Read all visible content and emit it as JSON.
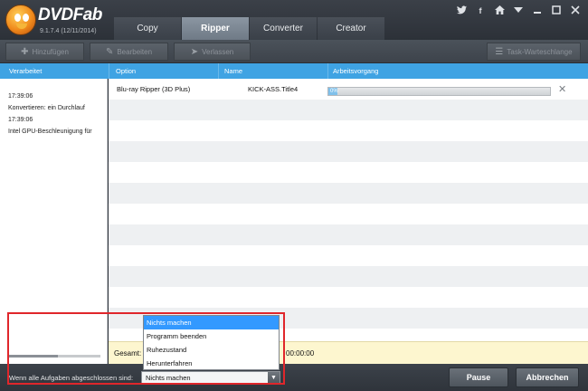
{
  "app": {
    "brand": "DVDFab",
    "version": "9.1.7.4 (12/11/2014)"
  },
  "tabs": [
    {
      "label": "Copy",
      "active": false
    },
    {
      "label": "Ripper",
      "active": true
    },
    {
      "label": "Converter",
      "active": false
    },
    {
      "label": "Creator",
      "active": false
    }
  ],
  "window_icons": [
    "twitter-icon",
    "facebook-icon",
    "home-icon",
    "menu-icon",
    "minimize-icon",
    "maximize-icon",
    "close-icon"
  ],
  "toolbar": {
    "add_label": "Hinzufügen",
    "edit_label": "Bearbeiten",
    "move_label": "Verlassen",
    "queue_label": "Task-Warteschlange",
    "enabled": false
  },
  "columns": {
    "processed": "Verarbeitet",
    "option": "Option",
    "name": "Name",
    "progress": "Arbeitsvorgang"
  },
  "log": [
    "17:39:06",
    "Konvertieren: ein Durchlauf",
    "17:39:06",
    "Intel GPU-Beschleunigung für"
  ],
  "tasks": [
    {
      "option": "Blu-ray Ripper (3D Plus)",
      "name": "KICK-ASS.Title4",
      "progress": 0,
      "progress_text": "0%"
    }
  ],
  "total": {
    "label": "Gesamt:",
    "time": "00:00:00"
  },
  "bottom": {
    "when_done_label": "Wenn alle Aufgaben abgeschlossen sind:",
    "selected": "Nichts machen",
    "options": [
      "Nichts machen",
      "Programm beenden",
      "Ruhezustand",
      "Herunterfahren"
    ],
    "pause_label": "Pause",
    "cancel_label": "Abbrechen"
  },
  "colors": {
    "accent": "#3fa3e3",
    "highlight": "#e0262b",
    "selected_option": "#3399ff"
  }
}
